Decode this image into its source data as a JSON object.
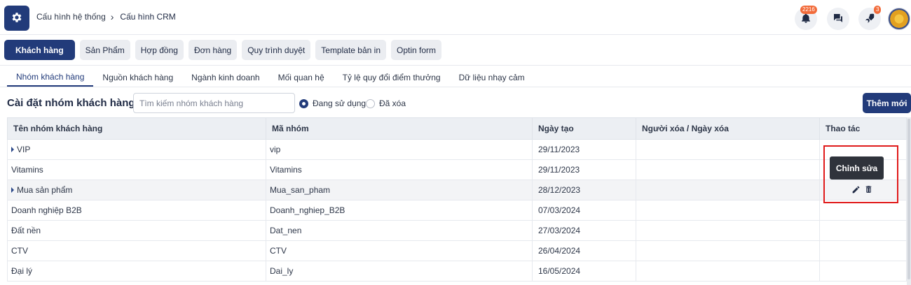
{
  "header": {
    "breadcrumb": [
      "Cấu hình hệ thống",
      "Cấu hình CRM"
    ],
    "notification_count": "2216",
    "rocket_count": "3",
    "icons": [
      "gear-icon",
      "bell-icon",
      "chat-icon",
      "rocket-icon",
      "avatar"
    ]
  },
  "main_tabs": [
    "Khách hàng",
    "Sản Phẩm",
    "Hợp đồng",
    "Đơn hàng",
    "Quy trình duyệt",
    "Template bản in",
    "Optin form"
  ],
  "sub_tabs": [
    "Nhóm khách hàng",
    "Nguồn khách hàng",
    "Ngành kinh doanh",
    "Mối quan hệ",
    "Tỷ lệ quy đổi điểm thưởng",
    "Dữ liệu nhạy cảm"
  ],
  "toolbar": {
    "title": "Cài đặt nhóm khách hàng",
    "search_placeholder": "Tìm kiếm nhóm khách hàng",
    "radio_active": "Đang sử dụng",
    "radio_deleted": "Đã xóa",
    "add_label": "Thêm mới"
  },
  "table": {
    "columns": [
      "Tên nhóm khách hàng",
      "Mã nhóm",
      "Ngày tạo",
      "Người xóa / Ngày xóa",
      "Thao tác"
    ],
    "rows": [
      {
        "name": "VIP",
        "code": "vip",
        "date": "29/11/2023",
        "deleted": "",
        "expandable": true
      },
      {
        "name": "Vitamins",
        "code": "Vitamins",
        "date": "29/11/2023",
        "deleted": "",
        "expandable": false
      },
      {
        "name": "Mua sản phẩm",
        "code": "Mua_san_pham",
        "date": "28/12/2023",
        "deleted": "",
        "expandable": true
      },
      {
        "name": "Doanh nghiệp B2B",
        "code": "Doanh_nghiep_B2B",
        "date": "07/03/2024",
        "deleted": "",
        "expandable": false
      },
      {
        "name": "Đất nền",
        "code": "Dat_nen",
        "date": "27/03/2024",
        "deleted": "",
        "expandable": false
      },
      {
        "name": "CTV",
        "code": "CTV",
        "date": "26/04/2024",
        "deleted": "",
        "expandable": false
      },
      {
        "name": "Đại lý",
        "code": "Dai_ly",
        "date": "16/05/2024",
        "deleted": "",
        "expandable": false
      }
    ]
  },
  "tooltip": "Chỉnh sửa",
  "colors": {
    "primary": "#223b7a",
    "highlight": "#e01a1a",
    "badge": "#f26b3a"
  }
}
